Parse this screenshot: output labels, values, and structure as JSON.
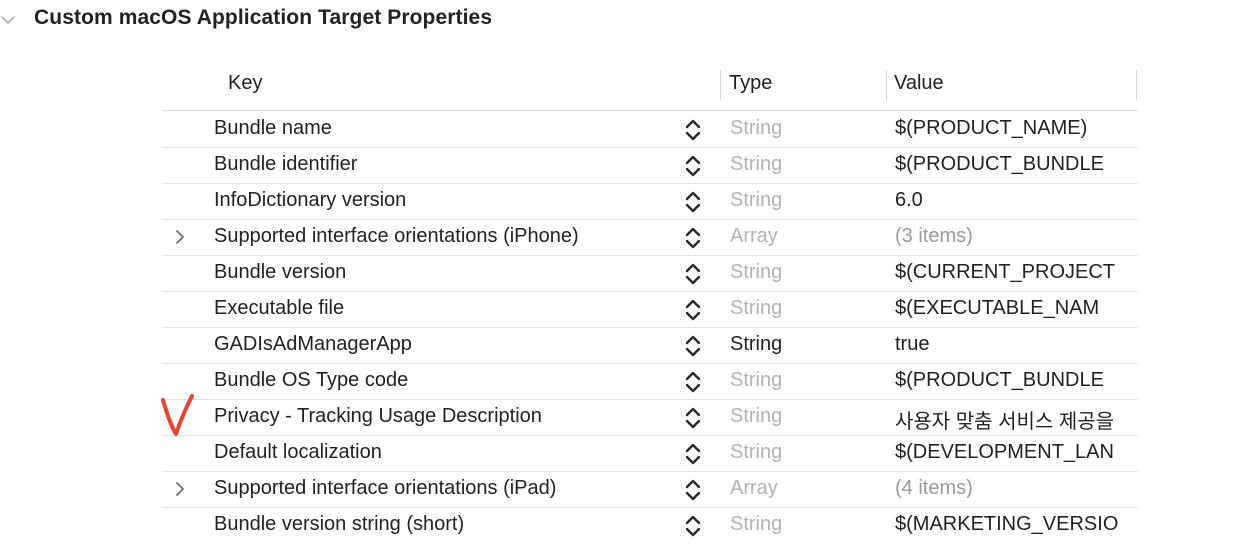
{
  "section": {
    "title": "Custom macOS Application Target Properties",
    "chevron_icon": "chevron-down-icon"
  },
  "table": {
    "columns": {
      "key": "Key",
      "type": "Type",
      "value": "Value"
    },
    "rows": [
      {
        "key": "Bundle name",
        "type": "String",
        "type_emphasis": false,
        "value": "$(PRODUCT_NAME)",
        "value_muted": false,
        "expandable": false
      },
      {
        "key": "Bundle identifier",
        "type": "String",
        "type_emphasis": false,
        "value": "$(PRODUCT_BUNDLE",
        "value_muted": false,
        "expandable": false
      },
      {
        "key": "InfoDictionary version",
        "type": "String",
        "type_emphasis": false,
        "value": "6.0",
        "value_muted": false,
        "expandable": false
      },
      {
        "key": "Supported interface orientations (iPhone)",
        "type": "Array",
        "type_emphasis": false,
        "value": "(3 items)",
        "value_muted": true,
        "expandable": true
      },
      {
        "key": "Bundle version",
        "type": "String",
        "type_emphasis": false,
        "value": "$(CURRENT_PROJECT",
        "value_muted": false,
        "expandable": false
      },
      {
        "key": "Executable file",
        "type": "String",
        "type_emphasis": false,
        "value": "$(EXECUTABLE_NAM",
        "value_muted": false,
        "expandable": false
      },
      {
        "key": "GADIsAdManagerApp",
        "type": "String",
        "type_emphasis": true,
        "value": "true",
        "value_muted": false,
        "expandable": false
      },
      {
        "key": "Bundle OS Type code",
        "type": "String",
        "type_emphasis": false,
        "value": "$(PRODUCT_BUNDLE",
        "value_muted": false,
        "expandable": false
      },
      {
        "key": "Privacy - Tracking Usage Description",
        "type": "String",
        "type_emphasis": false,
        "value": "사용자 맞춤 서비스 제공을",
        "value_muted": false,
        "expandable": false
      },
      {
        "key": "Default localization",
        "type": "String",
        "type_emphasis": false,
        "value": "$(DEVELOPMENT_LAN",
        "value_muted": false,
        "expandable": false
      },
      {
        "key": "Supported interface orientations (iPad)",
        "type": "Array",
        "type_emphasis": false,
        "value": "(4 items)",
        "value_muted": true,
        "expandable": true
      },
      {
        "key": "Bundle version string (short)",
        "type": "String",
        "type_emphasis": false,
        "value": "$(MARKETING_VERSIO",
        "value_muted": false,
        "expandable": false
      }
    ]
  },
  "annotation": {
    "icon": "red-checkmark-icon",
    "color": "#e8432e"
  },
  "colors": {
    "text": "#222222",
    "muted_type": "#b3b3b3",
    "muted_value": "#9a9a9a",
    "separator": "#e4e4e4"
  }
}
